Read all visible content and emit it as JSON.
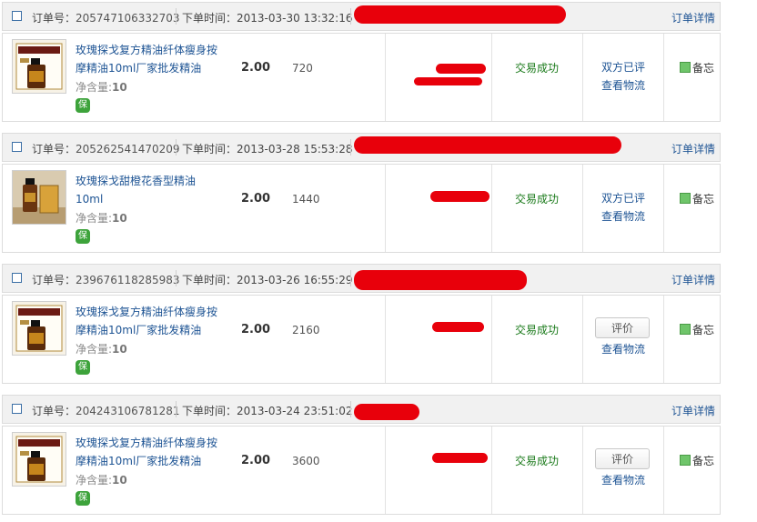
{
  "labels": {
    "order_no": "订单号：",
    "order_time": "下单时间：",
    "order_detail": "订单详情",
    "net_content": "净含量:",
    "protect_badge": "保",
    "rate_both": "双方已评",
    "view_logistics": "查看物流",
    "rate_button": "评价",
    "memo": "备忘"
  },
  "colors": {
    "link": "#1e5494",
    "success": "#1a7a1a",
    "redaction": "#e8000b",
    "header_bg": "#f1f1f1"
  },
  "orders": [
    {
      "order_no": "205747106332703",
      "time": "2013-03-30 13:32:16",
      "product": "玫瑰探戈复方精油纤体瘦身按摩精油10ml厂家批发精油",
      "net": "10",
      "price": "2.00",
      "qty": "720",
      "status": "交易成功",
      "review": "双方已评",
      "thumb": "boxed-bottle"
    },
    {
      "order_no": "205262541470209",
      "time": "2013-03-28 15:53:28",
      "product": "玫瑰探戈甜橙花香型精油10ml",
      "net": "10",
      "price": "2.00",
      "qty": "1440",
      "status": "交易成功",
      "review": "双方已评",
      "thumb": "bottle-photo"
    },
    {
      "order_no": "239676118285983",
      "time": "2013-03-26 16:55:29",
      "product": "玫瑰探戈复方精油纤体瘦身按摩精油10ml厂家批发精油",
      "net": "10",
      "price": "2.00",
      "qty": "2160",
      "status": "交易成功",
      "review": "",
      "thumb": "boxed-bottle"
    },
    {
      "order_no": "204243106781281",
      "time": "2013-03-24 23:51:02",
      "product": "玫瑰探戈复方精油纤体瘦身按摩精油10ml厂家批发精油",
      "net": "10",
      "price": "2.00",
      "qty": "3600",
      "status": "交易成功",
      "review": "",
      "thumb": "boxed-bottle"
    }
  ]
}
